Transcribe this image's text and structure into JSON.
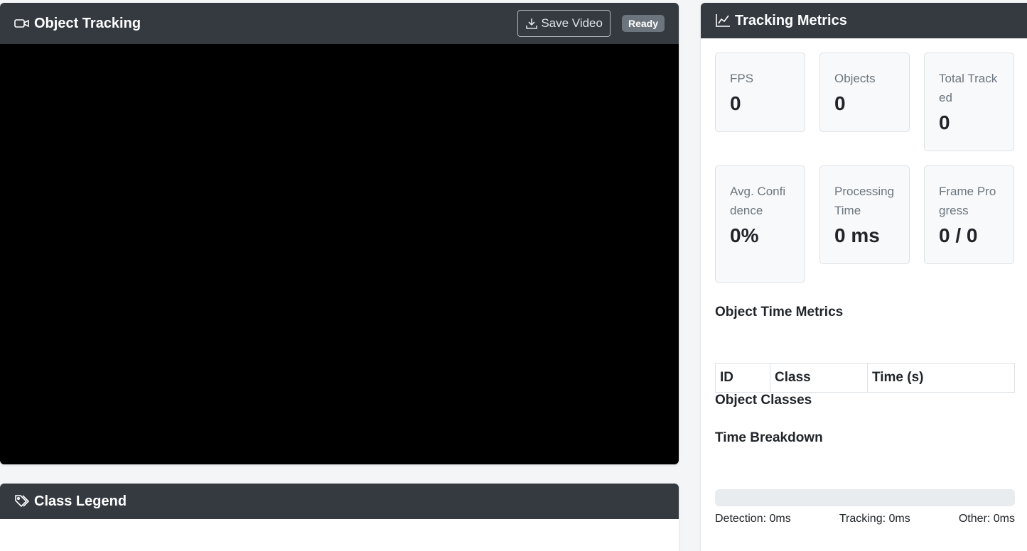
{
  "tracking": {
    "title": "Object Tracking",
    "save_label": "Save Video",
    "status": "Ready"
  },
  "legend": {
    "title": "Class Legend"
  },
  "metrics": {
    "title": "Tracking Metrics",
    "boxes": [
      {
        "label": "FPS",
        "value": "0"
      },
      {
        "label": "Objects",
        "value": "0"
      },
      {
        "label": "Total Tracked",
        "value": "0"
      },
      {
        "label": "Avg. Confidence",
        "value": "0%"
      },
      {
        "label": "Processing Time",
        "value": "0 ms"
      },
      {
        "label": "Frame Progress",
        "value": "0 / 0"
      }
    ],
    "object_time_title": "Object Time Metrics",
    "table_headers": [
      "ID",
      "Class",
      "Time (s)"
    ],
    "object_classes_title": "Object Classes",
    "time_breakdown_title": "Time Breakdown",
    "detection_label": "Detection: 0ms",
    "tracking_label": "Tracking: 0ms",
    "other_label": "Other: 0ms",
    "breakdown_progress_percent": 0
  },
  "icons": {
    "tracking": "video-camera-icon",
    "save": "download-icon",
    "legend": "tags-icon",
    "metrics": "line-chart-icon"
  }
}
